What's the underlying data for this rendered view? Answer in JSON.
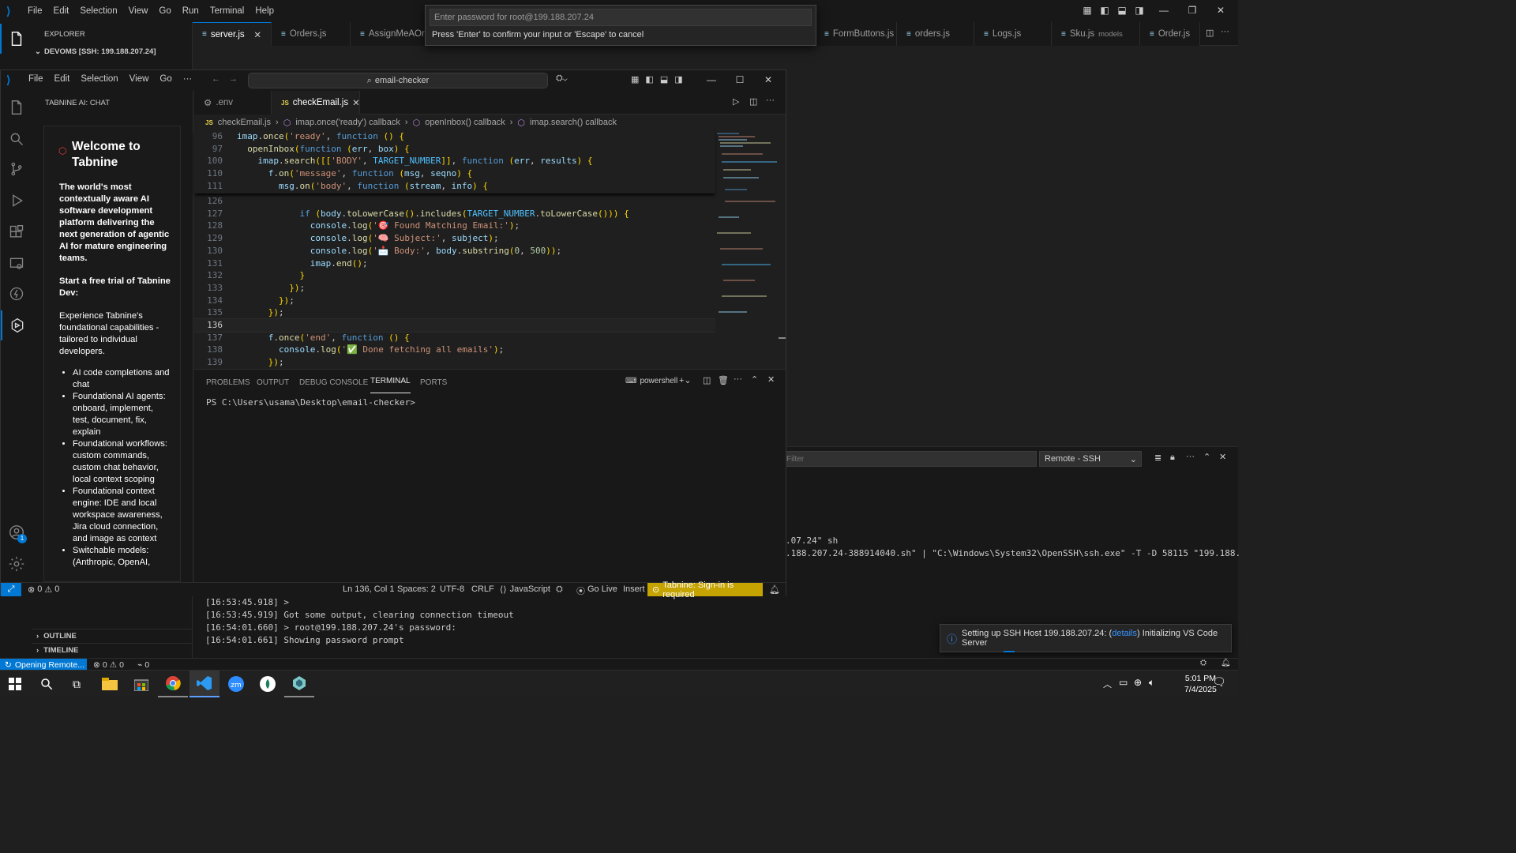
{
  "back_window": {
    "menu": [
      "File",
      "Edit",
      "Selection",
      "View",
      "Go",
      "Run",
      "Terminal",
      "Help"
    ],
    "explorer_title": "EXPLORER",
    "explorer_root": "DEVOMS [SSH: 199.188.207.24]",
    "outline": "OUTLINE",
    "timeline": "TIMELINE",
    "tabs": [
      {
        "label": "server.js",
        "active": true
      },
      {
        "label": "Orders.js"
      },
      {
        "label": "AssignMeAOrd"
      },
      {
        "label": "FormButtons.js"
      },
      {
        "label": "orders.js"
      },
      {
        "label": "Logs.js"
      },
      {
        "label": "Sku.js",
        "hint": "models"
      },
      {
        "label": "Order.js"
      }
    ],
    "panel": {
      "filter_placeholder": "Filter",
      "dropdown": "Remote - SSH",
      "lines": [
        ".07.24\" sh",
        ".188.207.24-388914040.sh\" | \"C:\\Windows\\System32\\OpenSSH\\ssh.exe\" -T -D 58115 \"199.188.",
        "[16:53:45.918] >",
        "[16:53:45.919] Got some output, clearing connection timeout",
        "[16:54:01.660] > root@199.188.207.24's password:",
        "[16:54:01.661] Showing password prompt"
      ]
    },
    "notification": {
      "text_before": "Setting up SSH Host 199.188.207.24: (",
      "link": "details",
      "text_after": ") Initializing VS Code Server"
    },
    "status": {
      "remote": "Opening Remote...",
      "errors": "0",
      "warnings": "0",
      "ports": "0"
    }
  },
  "quick_input": {
    "placeholder": "Enter password for root@199.188.207.24",
    "message": "Press 'Enter' to confirm your input or 'Escape' to cancel"
  },
  "front_window": {
    "menu": [
      "File",
      "Edit",
      "Selection",
      "View",
      "Go"
    ],
    "more": "···",
    "search_label": "email-checker",
    "sidebar_title": "TABNINE AI: CHAT",
    "tabnine": {
      "title": "Welcome to Tabnine",
      "intro": "The world's most contextually aware AI software development platform delivering the next generation of agentic AI for mature engineering teams.",
      "trial": "Start a free trial of Tabnine Dev:",
      "experience": "Experience Tabnine's foundational capabilities - tailored to individual developers.",
      "features": [
        "AI code completions and chat",
        "Foundational AI agents: onboard, implement, test, document, fix, explain",
        "Foundational workflows: custom commands, custom chat behavior, local context scoping",
        "Foundational context engine: IDE and local workspace awareness, Jira cloud connection, and image as context",
        "Switchable models: (Anthropic, OpenAI,"
      ]
    },
    "editor_tabs": [
      {
        "label": ".env"
      },
      {
        "label": "checkEmail.js",
        "active": true
      }
    ],
    "breadcrumb": [
      "checkEmail.js",
      "imap.once('ready') callback",
      "openInbox() callback",
      "imap.search() callback"
    ],
    "sticky_lines": [
      {
        "n": "96",
        "code": "imap.once('ready', function () {"
      },
      {
        "n": "97",
        "code": "  openInbox(function (err, box) {"
      },
      {
        "n": "100",
        "code": "    imap.search([['BODY', TARGET_NUMBER]], function (err, results) {"
      },
      {
        "n": "110",
        "code": "      f.on('message', function (msg, seqno) {"
      },
      {
        "n": "111",
        "code": "        msg.on('body', function (stream, info) {"
      }
    ],
    "code_lines": [
      {
        "n": "126",
        "code": ""
      },
      {
        "n": "127",
        "code": "            if (body.toLowerCase().includes(TARGET_NUMBER.toLowerCase())) {"
      },
      {
        "n": "128",
        "code": "              console.log('🎯 Found Matching Email:');"
      },
      {
        "n": "129",
        "code": "              console.log('🧠 Subject:', subject);"
      },
      {
        "n": "130",
        "code": "              console.log('📩 Body:', body.substring(0, 500));"
      },
      {
        "n": "131",
        "code": "              imap.end();"
      },
      {
        "n": "132",
        "code": "            }"
      },
      {
        "n": "133",
        "code": "          });"
      },
      {
        "n": "134",
        "code": "        });"
      },
      {
        "n": "135",
        "code": "      });"
      },
      {
        "n": "136",
        "code": ""
      },
      {
        "n": "137",
        "code": "      f.once('end', function () {"
      },
      {
        "n": "138",
        "code": "        console.log('✅ Done fetching all emails');"
      },
      {
        "n": "139",
        "code": "      });"
      }
    ],
    "panel_tabs": [
      "PROBLEMS",
      "OUTPUT",
      "DEBUG CONSOLE",
      "TERMINAL",
      "PORTS"
    ],
    "active_panel_tab": "TERMINAL",
    "shell": "powershell",
    "terminal_prompt": "PS C:\\Users\\usama\\Desktop\\email-checker>",
    "status": {
      "errors": "0",
      "warnings": "0",
      "position": "Ln 136, Col 1",
      "spaces": "Spaces: 2",
      "encoding": "UTF-8",
      "eol": "CRLF",
      "language": "JavaScript",
      "golive": "Go Live",
      "mode": "Insert",
      "tabnine": "Tabnine: Sign-in is required"
    }
  },
  "taskbar": {
    "time": "5:01 PM",
    "date": "7/4/2025"
  },
  "colors": {
    "accent": "#0078d4",
    "tabnine_status": "#c5a300"
  }
}
